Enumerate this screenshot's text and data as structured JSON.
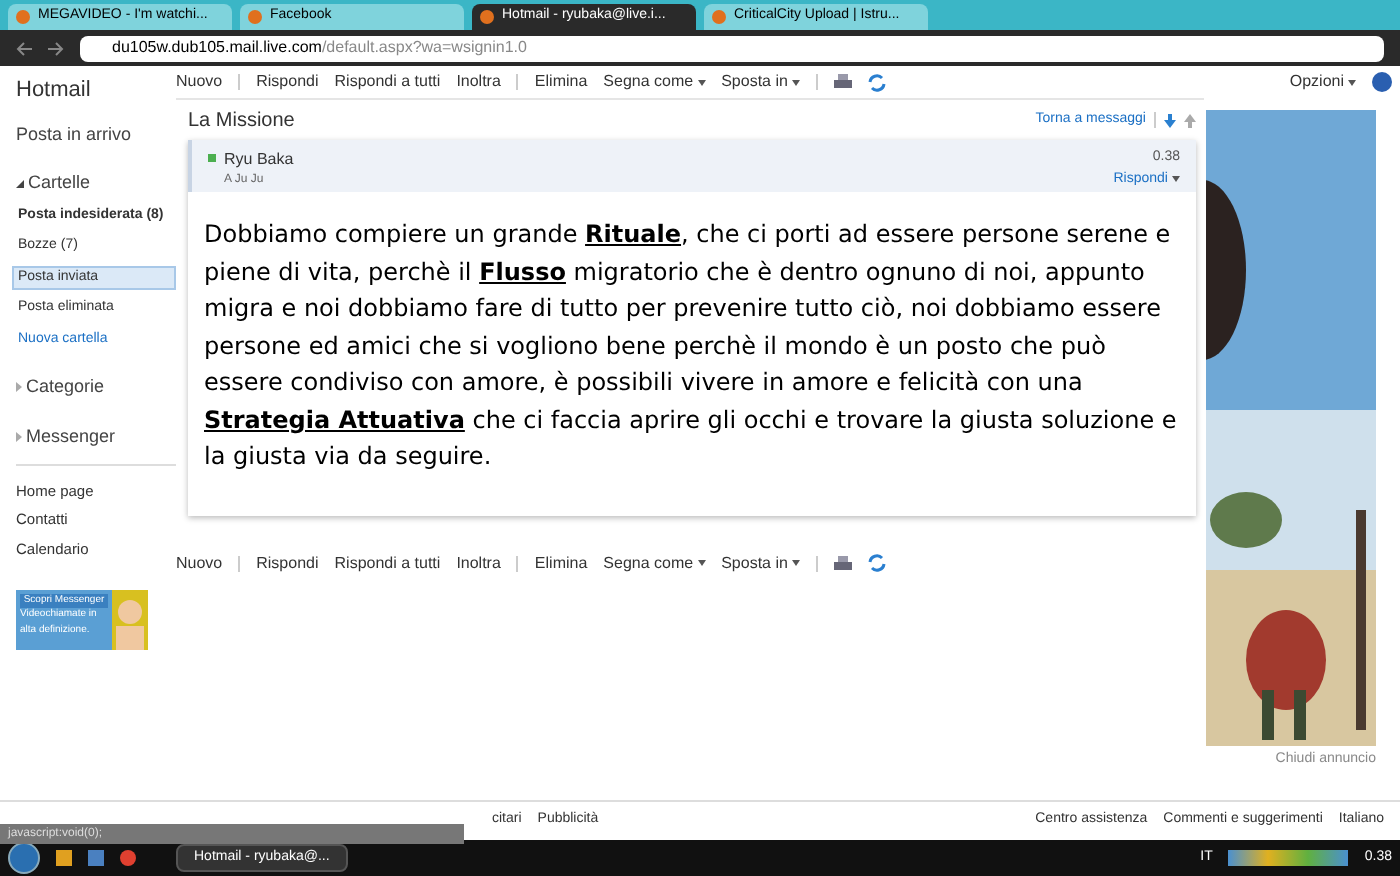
{
  "browser": {
    "tabs": [
      {
        "label": "MEGAVIDEO - I'm watchi...",
        "selected": false
      },
      {
        "label": "Facebook",
        "selected": false
      },
      {
        "label": "Hotmail - ryubaka@live.i...",
        "selected": true
      },
      {
        "label": "CriticalCity Upload | Istru...",
        "selected": false
      }
    ],
    "url_host": "du105w.dub105.mail.live.com",
    "url_path": "/default.aspx?wa=wsignin1.0"
  },
  "app_title": "Hotmail",
  "toolbar_top": [
    {
      "kind": "button",
      "label": "Nuovo"
    },
    {
      "kind": "separator"
    },
    {
      "kind": "button",
      "label": "Rispondi"
    },
    {
      "kind": "button",
      "label": "Rispondi a tutti"
    },
    {
      "kind": "button",
      "label": "Inoltra"
    },
    {
      "kind": "separator"
    },
    {
      "kind": "button",
      "label": "Elimina"
    },
    {
      "kind": "dropdown",
      "label": "Segna come"
    },
    {
      "kind": "dropdown",
      "label": "Sposta in"
    },
    {
      "kind": "separator"
    }
  ],
  "toolbar_bottom": [
    {
      "kind": "button",
      "label": "Nuovo"
    },
    {
      "kind": "separator"
    },
    {
      "kind": "button",
      "label": "Rispondi"
    },
    {
      "kind": "button",
      "label": "Rispondi a tutti"
    },
    {
      "kind": "button",
      "label": "Inoltra"
    },
    {
      "kind": "separator"
    },
    {
      "kind": "button",
      "label": "Elimina"
    },
    {
      "kind": "dropdown",
      "label": "Segna come"
    },
    {
      "kind": "dropdown",
      "label": "Sposta in"
    },
    {
      "kind": "separator"
    }
  ],
  "options": "Opzioni",
  "sidebar": {
    "inbox": "Posta in arrivo",
    "folders_header": "Cartelle",
    "folders": [
      {
        "label": "Posta indesiderata (8)",
        "bold": true,
        "selected": false,
        "kind": "folder"
      },
      {
        "label": "Bozze (7)",
        "bold": false,
        "selected": false,
        "kind": "folder"
      },
      {
        "label": "Posta inviata",
        "bold": false,
        "selected": true,
        "kind": "folder"
      },
      {
        "label": "Posta eliminata",
        "bold": false,
        "selected": false,
        "kind": "folder"
      },
      {
        "label": "Nuova cartella",
        "bold": false,
        "selected": false,
        "kind": "link"
      }
    ],
    "sections": [
      "Categorie",
      "Messenger"
    ],
    "links": [
      "Home page",
      "Contatti",
      "Calendario"
    ],
    "promo": {
      "title": "Scopri Messenger",
      "text": "Videochiamate in alta definizione."
    }
  },
  "message": {
    "subject": "La Missione",
    "back": "Torna a messaggi",
    "sender": "Ryu Baka",
    "recipient": "A Ju Ju",
    "time": "0.38",
    "reply": "Rispondi",
    "body": "Dobbiamo compiere un grande **Rituale**, che ci porti ad essere persone serene e piene di vita, perchè il **Flusso** migratorio che è dentro ognuno di noi, appunto migra e noi dobbiamo fare di tutto per prevenire tutto ciò, noi dobbiamo essere persone ed amici che si vogliono bene perchè il mondo è un posto che può essere condiviso con amore, è possibili vivere in amore e felicità con una **Strategia Attuativa** che ci faccia aprire gli occhi e trovare la giusta soluzione e la giusta via da seguire."
  },
  "ad": {
    "close": "Chiudi annuncio"
  },
  "footer": {
    "left": [
      "citari",
      "Pubblicità"
    ],
    "right": [
      "Centro assistenza",
      "Commenti e suggerimenti",
      "Italiano"
    ]
  },
  "status_tip": "javascript:void(0);",
  "taskbar": {
    "window": "Hotmail - ryubaka@...",
    "lang": "IT",
    "time": "0.38"
  }
}
